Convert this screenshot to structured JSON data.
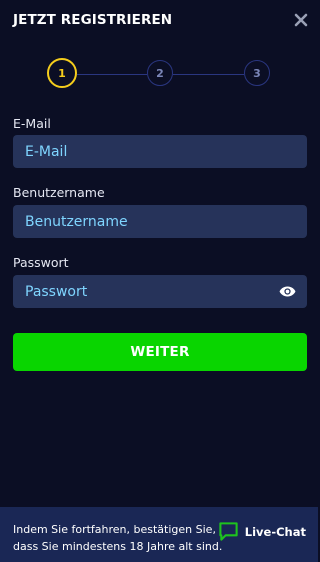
{
  "header": {
    "title": "JETZT REGISTRIEREN",
    "close_icon": "close-icon"
  },
  "stepper": {
    "steps": [
      {
        "label": "1",
        "active": true
      },
      {
        "label": "2",
        "active": false
      },
      {
        "label": "3",
        "active": false
      }
    ],
    "active_color": "#f5cd1c"
  },
  "form": {
    "email": {
      "label": "E-Mail",
      "placeholder": "E-Mail",
      "value": ""
    },
    "username": {
      "label": "Benutzername",
      "placeholder": "Benutzername",
      "value": ""
    },
    "password": {
      "label": "Passwort",
      "placeholder": "Passwort",
      "value": "",
      "toggle_icon": "eye-icon"
    },
    "submit_label": "WEITER"
  },
  "footer": {
    "notice": "Indem Sie fortfahren, bestätigen Sie, dass Sie mindestens 18 Jahre alt sind.",
    "livechat_label": "Live-Chat",
    "livechat_icon": "chat-bubble-icon"
  },
  "colors": {
    "background": "#0b0e24",
    "field_background": "#26335a",
    "submit_button": "#09d500",
    "footer_background": "#1a2755",
    "accent_step": "#f5cd1c",
    "chat_icon": "#1ec31e"
  }
}
